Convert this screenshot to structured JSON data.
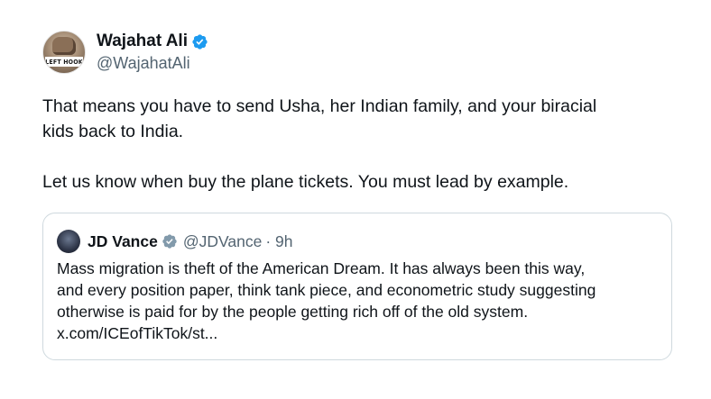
{
  "author": {
    "display_name": "Wajahat Ali",
    "handle": "@WajahatAli",
    "avatar_text": "LEFT HOOK",
    "verified_icon": "verified-badge-blue"
  },
  "body": {
    "line1": "That means you have to send Usha, her Indian family, and your biracial",
    "line2": "kids back to India.",
    "line3": "Let us know when buy the plane tickets. You must lead by example."
  },
  "quote": {
    "display_name": "JD Vance",
    "handle": "@JDVance",
    "time": "· 9h",
    "verified_icon": "verified-badge-gray",
    "text_line1": "Mass migration is theft of the American Dream. It has always been this way,",
    "text_line2": "and every position paper, think tank piece, and econometric study suggesting",
    "text_line3": "otherwise is paid for by the people getting rich off of the old system.",
    "text_line4": "x.com/ICEofTikTok/st..."
  },
  "colors": {
    "text_primary": "#0f1419",
    "text_secondary": "#536471",
    "verified_blue": "#1d9bf0",
    "verified_gray": "#829aab",
    "border": "#cfd9de"
  }
}
